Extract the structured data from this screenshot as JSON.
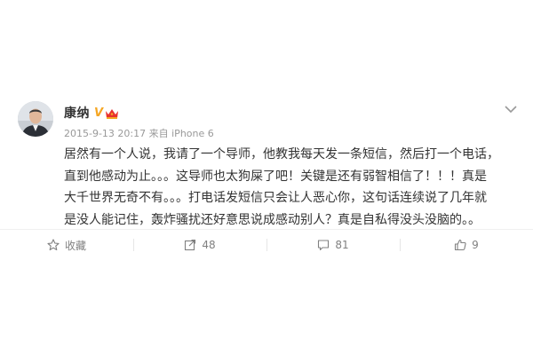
{
  "post": {
    "author": "康纳",
    "vip_badge": "V",
    "timestamp": "2015-9-13 20:17",
    "source_prefix": "来自",
    "source": "iPhone 6",
    "content_lines": [
      "居然有一个人说，我请了一个导师，他教我每天发一条短信，然后打一个电话，",
      "直到他感动为止。。。这导师也太狗屎了吧！关键是还有弱智相信了！！！真是",
      "大千世界无奇不有。。。打电话发短信只会让人恶心你，这句话连续说了几年就",
      "是没人能记住，轰炸骚扰还好意思说成感动别人？真是自私得没头没脑的。。"
    ]
  },
  "actions": {
    "favorite_label": "收藏",
    "repost_count": "48",
    "comment_count": "81",
    "like_count": "9"
  },
  "icons": {
    "vip": "vip-v-icon",
    "crown": "crown-icon",
    "more": "chevron-down-icon",
    "favorite": "star-icon",
    "repost": "share-icon",
    "comment": "comment-icon",
    "like": "thumbs-up-icon"
  },
  "colors": {
    "vip": "#f5a623",
    "crown": "#e8312e",
    "text": "#333333",
    "meta": "#999999",
    "action": "#808080"
  }
}
